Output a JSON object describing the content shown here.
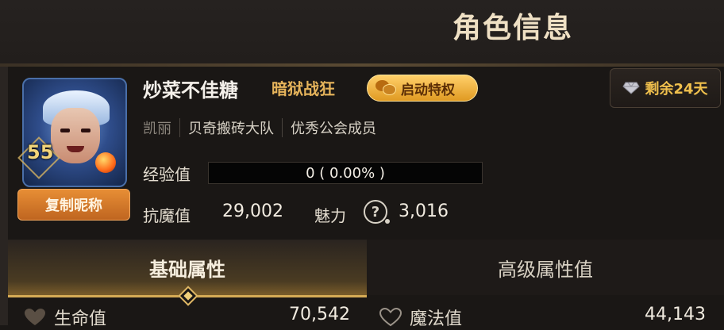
{
  "header": {
    "title": "角色信息"
  },
  "profile": {
    "level": "55",
    "copy_button": "复制昵称",
    "name": "炒菜不佳糖",
    "title_tag": "暗狱战狂",
    "privilege_button": "启动特权",
    "remaining": "剩余24天",
    "hero_name": "凯丽",
    "guild": "贝奇搬砖大队",
    "guild_role": "优秀公会成员"
  },
  "exp": {
    "label": "经验值",
    "text": "0 ( 0.00% )",
    "progress": 0
  },
  "stats": {
    "resist_label": "抗魔值",
    "resist_value": "29,002",
    "charm_label": "魅力",
    "help_glyph": "?",
    "charm_value": "3,016"
  },
  "tabs": {
    "basic": "基础属性",
    "advanced": "高级属性值"
  },
  "attributes": [
    {
      "label": "生命值",
      "value": "70,542"
    },
    {
      "label": "魔法值",
      "value": "44,143"
    }
  ],
  "colors": {
    "accent_gold": "#d6ab55",
    "button_orange": "#e78e35",
    "title_tag": "#e6b45b"
  },
  "icons": {
    "privilege": "wechat-icon",
    "remaining": "diamond-icon",
    "charm_help": "question-icon",
    "attribute": "heart-icon"
  }
}
